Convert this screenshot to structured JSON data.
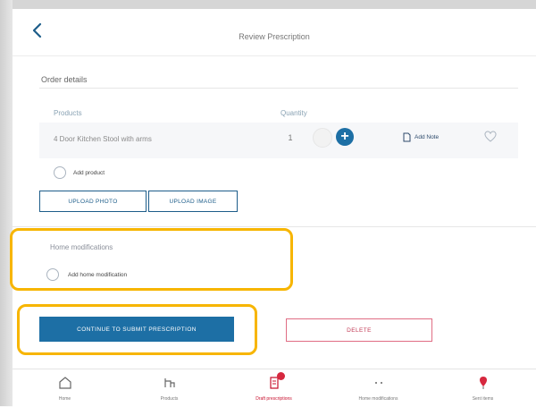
{
  "colors": {
    "primary": "#1d6fa5",
    "danger": "#c23a55",
    "highlight": "#f7b500",
    "active_nav": "#c8102e"
  },
  "header": {
    "back_icon": "chevron-left-icon",
    "title": "Review Prescription"
  },
  "order_details": {
    "title": "Order details",
    "columns": [
      "Products",
      "Quantity"
    ],
    "product": {
      "name": "4 Door Kitchen Stool with arms",
      "quantity": "1",
      "add_note_label": "Add Note",
      "note_icon": "note-icon",
      "favorite_icon": "heart-icon"
    },
    "add_product_label": "Add product",
    "upload_photo_label": "UPLOAD PHOTO",
    "add_image_label": "UPLOAD IMAGE"
  },
  "home_modifications": {
    "title": "Home modifications",
    "add_label": "Add home modification"
  },
  "actions": {
    "continue_label": "CONTINUE TO SUBMIT PRESCRIPTION",
    "delete_label": "DELETE"
  },
  "bottom_nav": [
    {
      "label": "Home",
      "icon": "home-icon",
      "active": false
    },
    {
      "label": "Products",
      "icon": "products-icon",
      "active": false
    },
    {
      "label": "Draft prescriptions",
      "icon": "draft-prescriptions-icon",
      "active": true
    },
    {
      "label": "Home modifications",
      "icon": "home-modifications-icon",
      "active": false
    },
    {
      "label": "Sent items",
      "icon": "sent-items-icon",
      "active": false
    }
  ]
}
